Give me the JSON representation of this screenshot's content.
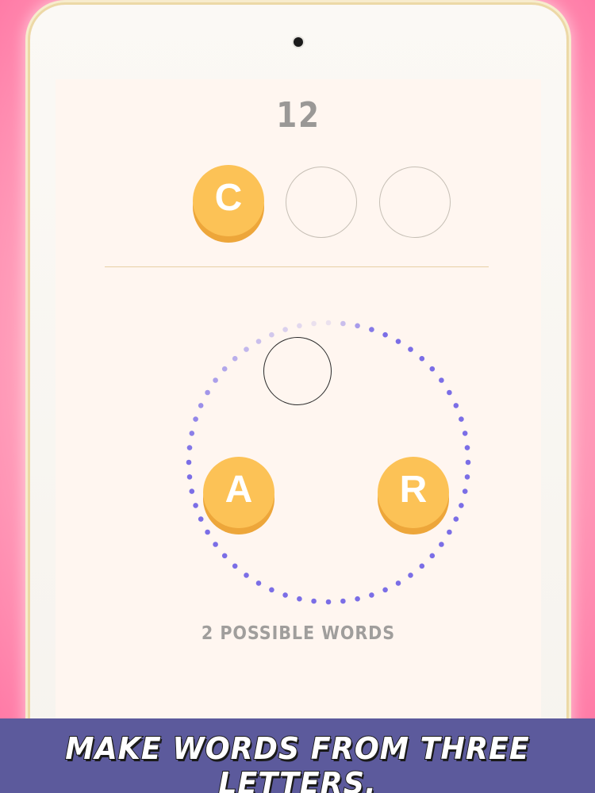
{
  "game": {
    "timer": "12",
    "answer_slots": [
      {
        "letter": "C",
        "filled": true
      },
      {
        "letter": "",
        "filled": false
      },
      {
        "letter": "",
        "filled": false
      }
    ],
    "wheel_letters": [
      {
        "position": "top",
        "letter": "",
        "state": "empty"
      },
      {
        "position": "left",
        "letter": "A",
        "state": "available"
      },
      {
        "position": "right",
        "letter": "R",
        "state": "available"
      }
    ],
    "possible_words": "2 POSSIBLE WORDS"
  },
  "caption": "MAKE WORDS FROM THREE LETTERS.",
  "colors": {
    "coin": "#fcc256",
    "coin_shadow": "#eda63a",
    "ring_dots": "#7b6ee6",
    "screen_bg": "#fff6f0",
    "caption_bar": "#5c5a9c"
  }
}
